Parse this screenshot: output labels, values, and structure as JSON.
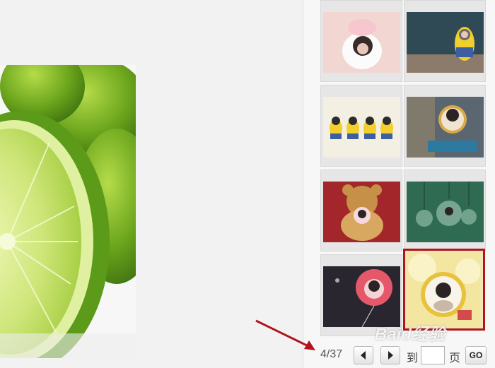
{
  "preview": {
    "image": "lime-photo"
  },
  "thumbnails": [
    {
      "name": "thumb-pig-mug",
      "selected": false
    },
    {
      "name": "thumb-minion-figure",
      "selected": false
    },
    {
      "name": "thumb-minion-group",
      "selected": false
    },
    {
      "name": "thumb-desk-frame",
      "selected": false
    },
    {
      "name": "thumb-teddy-bear",
      "selected": false
    },
    {
      "name": "thumb-light-bulbs",
      "selected": false
    },
    {
      "name": "thumb-pink-balloon",
      "selected": false
    },
    {
      "name": "thumb-yellow-flower",
      "selected": true
    }
  ],
  "pager": {
    "page_count": "4/37",
    "prev_icon": "chevron-left-icon",
    "next_icon": "chevron-right-icon",
    "label_to": "到",
    "page_input_value": "",
    "label_page": "页",
    "go_label": "GO"
  },
  "watermark": {
    "text": "Baid经验"
  },
  "colors": {
    "selection_border": "#b0151b",
    "annotation_arrow": "#b0151b"
  }
}
